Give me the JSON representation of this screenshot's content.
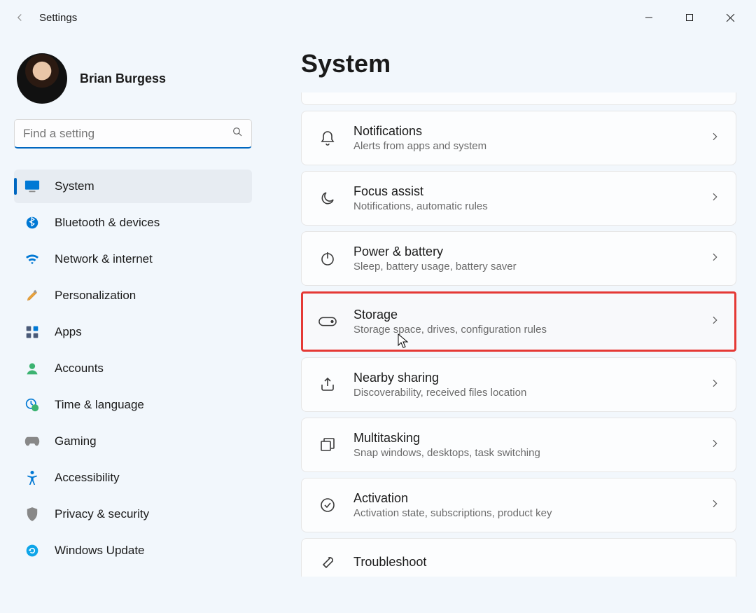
{
  "titlebar": {
    "title": "Settings"
  },
  "user": {
    "name": "Brian Burgess"
  },
  "search": {
    "placeholder": "Find a setting"
  },
  "sidebar": {
    "items": [
      {
        "key": "system",
        "label": "System",
        "active": true
      },
      {
        "key": "bluetooth",
        "label": "Bluetooth & devices",
        "active": false
      },
      {
        "key": "network",
        "label": "Network & internet",
        "active": false
      },
      {
        "key": "personalization",
        "label": "Personalization",
        "active": false
      },
      {
        "key": "apps",
        "label": "Apps",
        "active": false
      },
      {
        "key": "accounts",
        "label": "Accounts",
        "active": false
      },
      {
        "key": "time",
        "label": "Time & language",
        "active": false
      },
      {
        "key": "gaming",
        "label": "Gaming",
        "active": false
      },
      {
        "key": "accessibility",
        "label": "Accessibility",
        "active": false
      },
      {
        "key": "privacy",
        "label": "Privacy & security",
        "active": false
      },
      {
        "key": "update",
        "label": "Windows Update",
        "active": false
      }
    ]
  },
  "main": {
    "heading": "System",
    "cards": [
      {
        "key": "notifications",
        "title": "Notifications",
        "sub": "Alerts from apps and system",
        "highlight": false
      },
      {
        "key": "focus",
        "title": "Focus assist",
        "sub": "Notifications, automatic rules",
        "highlight": false
      },
      {
        "key": "power",
        "title": "Power & battery",
        "sub": "Sleep, battery usage, battery saver",
        "highlight": false
      },
      {
        "key": "storage",
        "title": "Storage",
        "sub": "Storage space, drives, configuration rules",
        "highlight": true
      },
      {
        "key": "nearby",
        "title": "Nearby sharing",
        "sub": "Discoverability, received files location",
        "highlight": false
      },
      {
        "key": "multitasking",
        "title": "Multitasking",
        "sub": "Snap windows, desktops, task switching",
        "highlight": false
      },
      {
        "key": "activation",
        "title": "Activation",
        "sub": "Activation state, subscriptions, product key",
        "highlight": false
      },
      {
        "key": "troubleshoot",
        "title": "Troubleshoot",
        "sub": "",
        "highlight": false
      }
    ]
  },
  "colors": {
    "accent": "#0067c0",
    "highlight": "#e53935"
  }
}
